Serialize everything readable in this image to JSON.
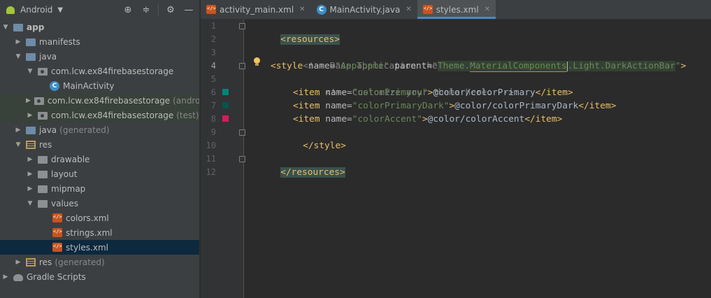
{
  "project_panel": {
    "view_title": "Android",
    "toolbar_icons": [
      "crosshair-icon",
      "collapse-all-icon",
      "gear-icon",
      "minimize-icon"
    ],
    "tree": [
      {
        "label": "app",
        "icon": "app-module-icon",
        "indent": 0,
        "expanded": true,
        "bold": true
      },
      {
        "label": "manifests",
        "icon": "folder-icon",
        "indent": 1,
        "expanded": false
      },
      {
        "label": "java",
        "icon": "folder-icon",
        "indent": 1,
        "expanded": true
      },
      {
        "label": "com.lcw.ex84firebasestorage",
        "icon": "package-icon",
        "indent": 2,
        "expanded": true
      },
      {
        "label": "MainActivity",
        "icon": "class-icon",
        "indent": 3
      },
      {
        "label": "com.lcw.ex84firebasestorage",
        "suffix": "(androidTe",
        "icon": "package-icon",
        "indent": 2,
        "expanded": false
      },
      {
        "label": "com.lcw.ex84firebasestorage",
        "suffix": "(test)",
        "icon": "package-icon",
        "indent": 2,
        "expanded": false
      },
      {
        "label": "java",
        "suffix": "(generated)",
        "icon": "generated-java-folder-icon",
        "indent": 1,
        "expanded": false
      },
      {
        "label": "res",
        "icon": "resources-folder-icon",
        "indent": 1,
        "expanded": true
      },
      {
        "label": "drawable",
        "icon": "folder-icon",
        "indent": 2,
        "expanded": false
      },
      {
        "label": "layout",
        "icon": "folder-icon",
        "indent": 2,
        "expanded": false
      },
      {
        "label": "mipmap",
        "icon": "folder-icon",
        "indent": 2,
        "expanded": false
      },
      {
        "label": "values",
        "icon": "folder-icon",
        "indent": 2,
        "expanded": true
      },
      {
        "label": "colors.xml",
        "icon": "xml-file-icon",
        "indent": 3
      },
      {
        "label": "strings.xml",
        "icon": "xml-file-icon",
        "indent": 3
      },
      {
        "label": "styles.xml",
        "icon": "xml-file-icon",
        "indent": 3,
        "selected": true
      },
      {
        "label": "res",
        "suffix": "(generated)",
        "icon": "resources-folder-icon",
        "indent": 1,
        "expanded": false
      },
      {
        "label": "Gradle Scripts",
        "icon": "gradle-icon",
        "indent": 0,
        "expanded": false
      }
    ]
  },
  "tabs": [
    {
      "label": "activity_main.xml",
      "icon": "xml-file-icon",
      "active": false
    },
    {
      "label": "MainActivity.java",
      "icon": "class-icon",
      "active": false
    },
    {
      "label": "styles.xml",
      "icon": "xml-file-icon",
      "active": true
    }
  ],
  "editor": {
    "line_numbers": [
      "1",
      "2",
      "3",
      "4",
      "5",
      "6",
      "7",
      "8",
      "9",
      "10",
      "11",
      "12"
    ],
    "current_line": "4",
    "colors": {
      "colorPrimary": "#008577",
      "colorPrimaryDark": "#00574B",
      "colorAccent": "#D81B60"
    },
    "code": {
      "l1_tag": "<resources>",
      "l3_comment": "<!-- Base application theme. -->",
      "l4_open": "<style ",
      "l4_attr1": "name=",
      "l4_val1": "\"AppTheme\"",
      "l4_attr2": "parent=",
      "l4_q1": "\"",
      "l4_theme": "Theme.",
      "l4_mc": "MaterialComponents",
      "l4_rest": ".Light.DarkActionBar",
      "l4_q2": "\"",
      "l4_close": ">",
      "l5_comment": "<!-- Customize your theme here. -->",
      "l6_open": "<item ",
      "l6_attr": "name=",
      "l6_val": "\"colorPrimary\"",
      "l6_gt": ">",
      "l6_text": "@color/colorPrimary",
      "l6_end": "</item>",
      "l7_open": "<item ",
      "l7_attr": "name=",
      "l7_val": "\"colorPrimaryDark\"",
      "l7_gt": ">",
      "l7_text": "@color/colorPrimaryDark",
      "l7_end": "</item>",
      "l8_open": "<item ",
      "l8_attr": "name=",
      "l8_val": "\"colorAccent\"",
      "l8_gt": ">",
      "l8_text": "@color/colorAccent",
      "l8_end": "</item>",
      "l9_tag": "</style>",
      "l11_tag": "</resources>"
    }
  }
}
